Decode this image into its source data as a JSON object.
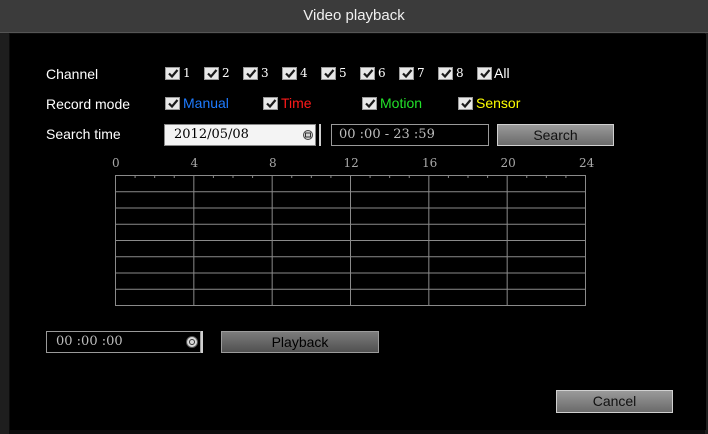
{
  "window": {
    "title": "Video playback"
  },
  "channel": {
    "label": "Channel",
    "items": [
      {
        "label": "1",
        "checked": true
      },
      {
        "label": "2",
        "checked": true
      },
      {
        "label": "3",
        "checked": true
      },
      {
        "label": "4",
        "checked": true
      },
      {
        "label": "5",
        "checked": true
      },
      {
        "label": "6",
        "checked": true
      },
      {
        "label": "7",
        "checked": true
      },
      {
        "label": "8",
        "checked": true
      }
    ],
    "all_label": "All"
  },
  "record_mode": {
    "label": "Record mode",
    "modes": [
      {
        "label": "Manual",
        "color": "#1e7bff",
        "checked": true
      },
      {
        "label": "Time",
        "color": "#ff1a1a",
        "checked": true
      },
      {
        "label": "Motion",
        "color": "#22e22a",
        "checked": true
      },
      {
        "label": "Sensor",
        "color": "#ffff00",
        "checked": true
      }
    ]
  },
  "search_time": {
    "label": "Search time",
    "date": "2012/05/08",
    "range": "00 :00 - 23 :59",
    "search_label": "Search"
  },
  "timeline": {
    "ticks": [
      "0",
      "4",
      "8",
      "12",
      "16",
      "20",
      "24"
    ],
    "rows": 8,
    "columns": 6
  },
  "playback": {
    "time": "00 :00 :00",
    "button_label": "Playback"
  },
  "footer": {
    "cancel_label": "Cancel"
  },
  "colors": {
    "checkbox_bg": "#e8e8e8",
    "grid_line": "#8a8a8a",
    "button_top": "#9a9a9a"
  }
}
